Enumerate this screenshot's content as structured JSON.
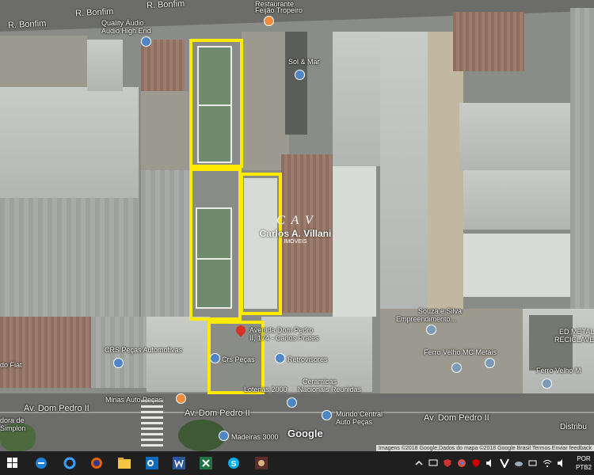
{
  "streets": {
    "bonfim_1": "R. Bonfim",
    "bonfim_2": "R. Bonfim",
    "bonfim_3": "R. Bonfim",
    "pedro_1": "Av. Dom Pedro II",
    "pedro_2": "Av. Dom Pedro II",
    "pedro_3": "Av. Dom Pedro II",
    "distrib": "Distribu"
  },
  "places": {
    "quality_audio": "Quality Áudio",
    "audio_high_end": "Audio High End",
    "restaurante_1": "Restaurante",
    "restaurante_2": "Feijão Tropeiro",
    "sol_mar": "Sol & Mar",
    "souza_1": "Souza e Silva",
    "souza_2": "Empreendimento...",
    "ferro_mc": "Ferro Velho MC Metais",
    "ed_metal_1": "ED METAL",
    "ed_metal_2": "RECICLAVE",
    "ferro_velho": "Ferro Velho M",
    "crs_auto": "CRS Peças Automotivas",
    "fiat": "do Fiat",
    "crs_pecas": "Crs Peças",
    "retrovisores": "Retrovisores",
    "loterias": "Loterias 2000",
    "ceramicas_1": "Ceramicas",
    "ceramicas_2": "Nacionais Reunidas",
    "minas": "Minas Auto Peças",
    "mundo_1": "Mundo Central",
    "mundo_2": "Auto Peças",
    "madeiras": "Madeiras 3000",
    "simplon_1": "dora de",
    "simplon_2": "Simplon",
    "address_1": "Avenida Dom Pedro",
    "address_2": "II, 174 - Carlos Prates"
  },
  "watermark": {
    "letters": "C  A  V",
    "name": "Carlos A. Villani",
    "sub": "IMÓVEIS"
  },
  "google_logo": "Google",
  "attribution": "Imagens ©2018 Google,Dados do mapa ©2018 Google   Brasil   Termos   Enviar feedback",
  "taskbar": {
    "lang_1": "POR",
    "lang_2": "PTB2"
  },
  "colors": {
    "highlight": "#ffea00",
    "pin": "#d93025",
    "poi_shop": "#4f86c6",
    "poi_food": "#f08b3e"
  }
}
